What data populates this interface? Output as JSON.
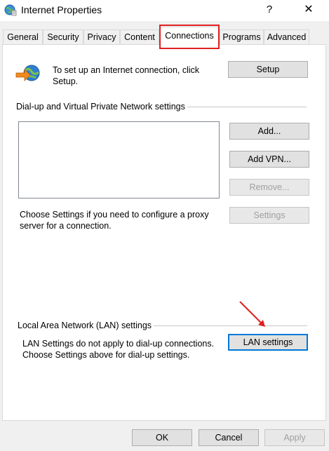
{
  "window": {
    "title": "Internet Properties",
    "help_glyph": "?",
    "close_glyph": "✕"
  },
  "tabs": [
    {
      "label": "General"
    },
    {
      "label": "Security"
    },
    {
      "label": "Privacy"
    },
    {
      "label": "Content"
    },
    {
      "label": "Connections"
    },
    {
      "label": "Programs"
    },
    {
      "label": "Advanced"
    }
  ],
  "setup": {
    "description": "To set up an Internet connection, click Setup.",
    "button": "Setup"
  },
  "dialup": {
    "group_label": "Dial-up and Virtual Private Network settings",
    "add_button": "Add...",
    "add_vpn_button": "Add VPN...",
    "remove_button": "Remove...",
    "settings_button": "Settings",
    "proxy_note": "Choose Settings if you need to configure a proxy server for a connection."
  },
  "lan": {
    "group_label": "Local Area Network (LAN) settings",
    "note": "LAN Settings do not apply to dial-up connections. Choose Settings above for dial-up settings.",
    "button": "LAN settings"
  },
  "footer": {
    "ok": "OK",
    "cancel": "Cancel",
    "apply": "Apply"
  },
  "colors": {
    "annotation_red": "#e02020",
    "focus_blue": "#0078d7"
  }
}
